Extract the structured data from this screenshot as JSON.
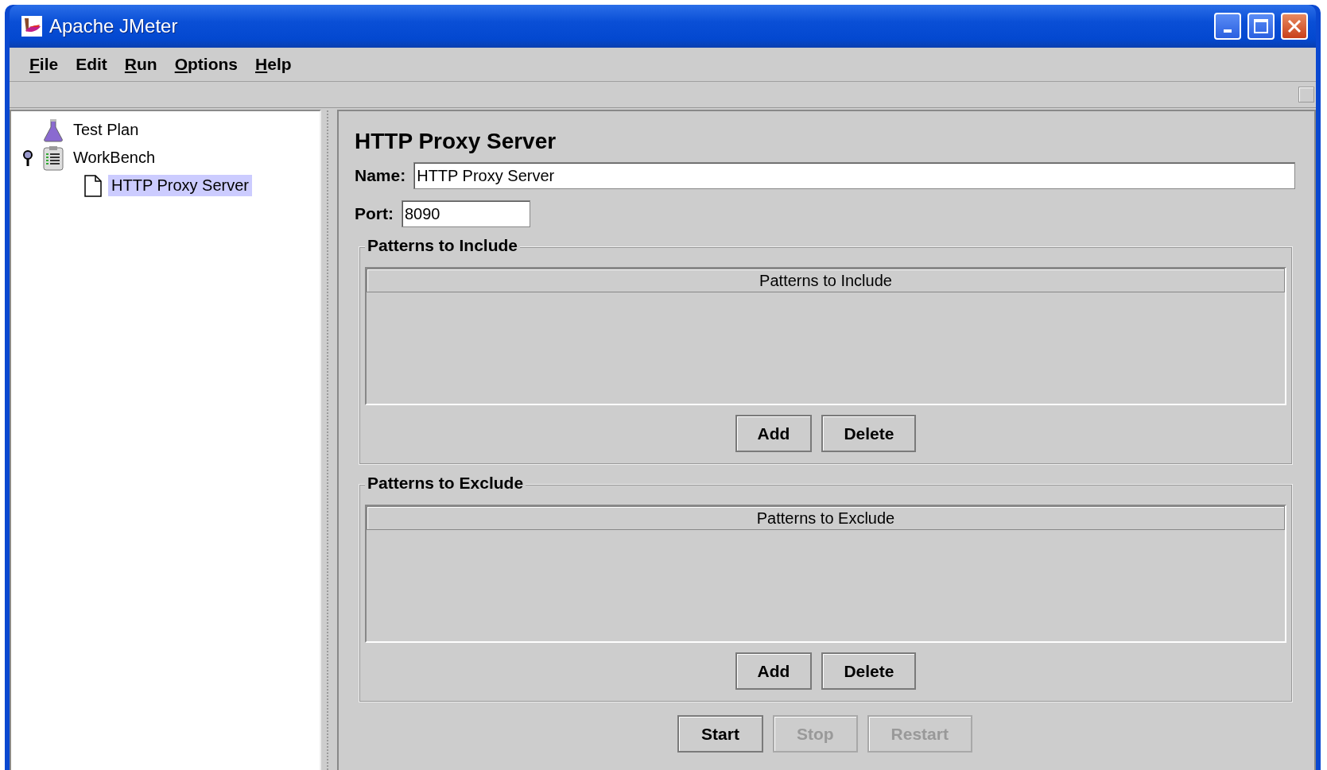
{
  "window": {
    "title": "Apache JMeter"
  },
  "menu": [
    {
      "label": "File",
      "underlined": true
    },
    {
      "label": "Edit",
      "underlined": false
    },
    {
      "label": "Run",
      "underlined": true
    },
    {
      "label": "Options",
      "underlined": true
    },
    {
      "label": "Help",
      "underlined": true
    }
  ],
  "tree": [
    {
      "label": "Test Plan",
      "kind": "flask",
      "selected": false
    },
    {
      "label": "WorkBench",
      "kind": "clipboard",
      "selected": false,
      "expanded": true,
      "children": [
        {
          "label": "HTTP Proxy Server",
          "kind": "page",
          "selected": true
        }
      ]
    }
  ],
  "editor": {
    "title": "HTTP Proxy Server",
    "fields": [
      {
        "label": "Name:",
        "value": "HTTP Proxy Server",
        "kind": "wide"
      },
      {
        "label": "Port:",
        "value": "8090",
        "kind": "short"
      }
    ],
    "groups": [
      {
        "title": "Patterns to Include",
        "column": "Patterns to Include",
        "buttons": [
          {
            "label": "Add",
            "disabled": false
          },
          {
            "label": "Delete",
            "disabled": false
          }
        ]
      },
      {
        "title": "Patterns to Exclude",
        "column": "Patterns to Exclude",
        "buttons": [
          {
            "label": "Add",
            "disabled": false
          },
          {
            "label": "Delete",
            "disabled": false
          }
        ]
      }
    ],
    "actions": [
      {
        "label": "Start",
        "disabled": false
      },
      {
        "label": "Stop",
        "disabled": true
      },
      {
        "label": "Restart",
        "disabled": true
      }
    ]
  }
}
